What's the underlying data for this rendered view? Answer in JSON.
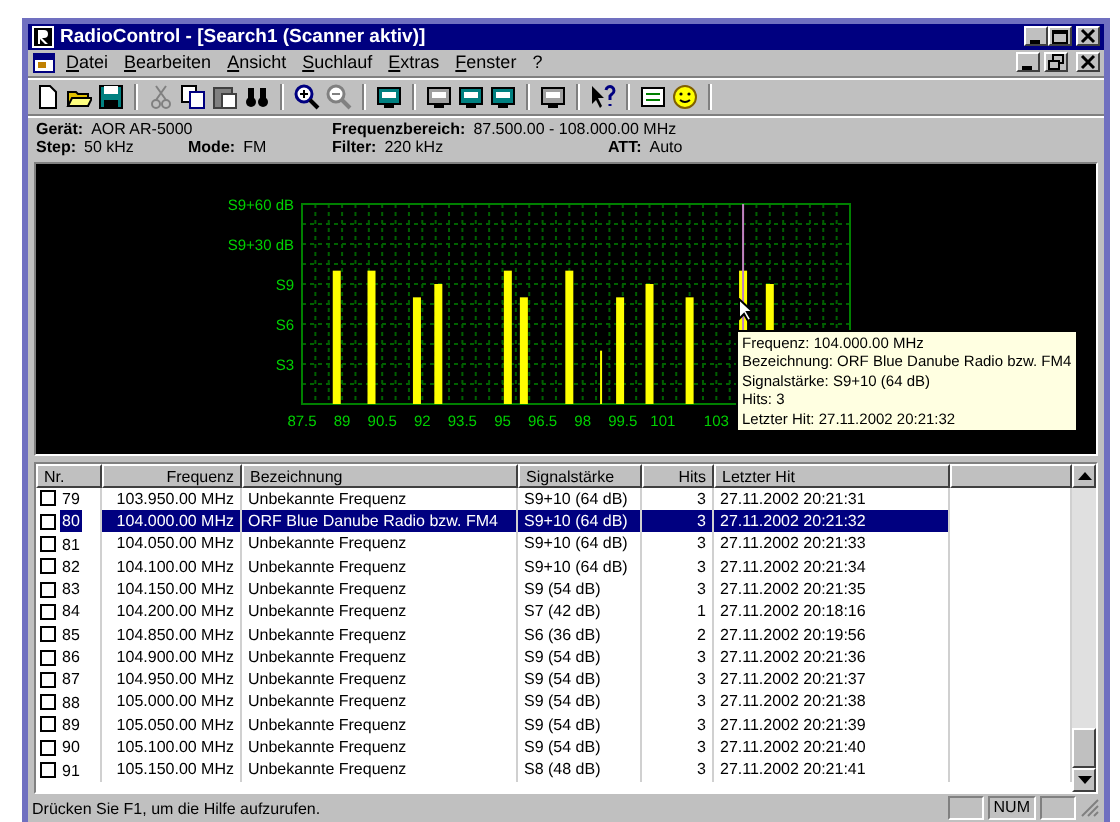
{
  "window": {
    "title": "RadioControl - [Search1 (Scanner aktiv)]"
  },
  "menu": [
    {
      "label": "Datei"
    },
    {
      "label": "Bearbeiten"
    },
    {
      "label": "Ansicht"
    },
    {
      "label": "Suchlauf"
    },
    {
      "label": "Extras"
    },
    {
      "label": "Fenster"
    },
    {
      "label": "?"
    }
  ],
  "info": [
    [
      {
        "label": "Gerät:",
        "value": "AOR AR-5000"
      },
      {
        "label": "Frequenzbereich:",
        "value": "87.500.00 - 108.000.00 MHz"
      }
    ],
    [
      {
        "label": "Step:",
        "value": "50 kHz"
      },
      {
        "label": "Mode:",
        "value": "FM"
      },
      {
        "label": "Filter:",
        "value": "220 kHz"
      },
      {
        "label": "ATT:",
        "value": "Auto"
      }
    ]
  ],
  "spectrum": {
    "y_axis_labels": [
      "S9+60 dB",
      "S9+30 dB",
      "S9",
      "S6",
      "S3"
    ],
    "x_axis_labels": [
      "87.5",
      "89",
      "90.5",
      "92",
      "93.5",
      "95",
      "96.5",
      "98",
      "99.5",
      "101",
      "103"
    ],
    "tooltip": [
      "Frequenz: 104.000.00 MHz",
      "Bezeichnung: ORF Blue Danube Radio bzw. FM4",
      "Signalstärke: S9+10 (64 dB)",
      "Hits: 3",
      "Letzter Hit: 27.11.2002 20:21:32"
    ]
  },
  "table": {
    "columns": [
      "Nr.",
      "Frequenz",
      "Bezeichnung",
      "Signalstärke",
      "Hits",
      "Letzter Hit"
    ],
    "rows": [
      {
        "nr": "79",
        "freq": "103.950.00 MHz",
        "name": "Unbekannte Frequenz",
        "signal": "S9+10 (64 dB)",
        "hits": "3",
        "last": "27.11.2002 20:21:31",
        "checked": false,
        "selected": false
      },
      {
        "nr": "80",
        "freq": "104.000.00 MHz",
        "name": "ORF Blue Danube Radio bzw. FM4",
        "signal": "S9+10 (64 dB)",
        "hits": "3",
        "last": "27.11.2002 20:21:32",
        "checked": false,
        "selected": true
      },
      {
        "nr": "81",
        "freq": "104.050.00 MHz",
        "name": "Unbekannte Frequenz",
        "signal": "S9+10 (64 dB)",
        "hits": "3",
        "last": "27.11.2002 20:21:33",
        "checked": false,
        "selected": false
      },
      {
        "nr": "82",
        "freq": "104.100.00 MHz",
        "name": "Unbekannte Frequenz",
        "signal": "S9+10 (64 dB)",
        "hits": "3",
        "last": "27.11.2002 20:21:34",
        "checked": false,
        "selected": false
      },
      {
        "nr": "83",
        "freq": "104.150.00 MHz",
        "name": "Unbekannte Frequenz",
        "signal": "S9 (54 dB)",
        "hits": "3",
        "last": "27.11.2002 20:21:35",
        "checked": false,
        "selected": false
      },
      {
        "nr": "84",
        "freq": "104.200.00 MHz",
        "name": "Unbekannte Frequenz",
        "signal": "S7 (42 dB)",
        "hits": "1",
        "last": "27.11.2002 20:18:16",
        "checked": false,
        "selected": false
      },
      {
        "nr": "85",
        "freq": "104.850.00 MHz",
        "name": "Unbekannte Frequenz",
        "signal": "S6 (36 dB)",
        "hits": "2",
        "last": "27.11.2002 20:19:56",
        "checked": false,
        "selected": false
      },
      {
        "nr": "86",
        "freq": "104.900.00 MHz",
        "name": "Unbekannte Frequenz",
        "signal": "S9 (54 dB)",
        "hits": "3",
        "last": "27.11.2002 20:21:36",
        "checked": false,
        "selected": false
      },
      {
        "nr": "87",
        "freq": "104.950.00 MHz",
        "name": "Unbekannte Frequenz",
        "signal": "S9 (54 dB)",
        "hits": "3",
        "last": "27.11.2002 20:21:37",
        "checked": false,
        "selected": false
      },
      {
        "nr": "88",
        "freq": "105.000.00 MHz",
        "name": "Unbekannte Frequenz",
        "signal": "S9 (54 dB)",
        "hits": "3",
        "last": "27.11.2002 20:21:38",
        "checked": false,
        "selected": false
      },
      {
        "nr": "89",
        "freq": "105.050.00 MHz",
        "name": "Unbekannte Frequenz",
        "signal": "S9 (54 dB)",
        "hits": "3",
        "last": "27.11.2002 20:21:39",
        "checked": false,
        "selected": false
      },
      {
        "nr": "90",
        "freq": "105.100.00 MHz",
        "name": "Unbekannte Frequenz",
        "signal": "S9 (54 dB)",
        "hits": "3",
        "last": "27.11.2002 20:21:40",
        "checked": false,
        "selected": false
      },
      {
        "nr": "91",
        "freq": "105.150.00 MHz",
        "name": "Unbekannte Frequenz",
        "signal": "S8 (48 dB)",
        "hits": "3",
        "last": "27.11.2002 20:21:41",
        "checked": false,
        "selected": false
      }
    ]
  },
  "status_bar": {
    "message": "Drücken Sie F1, um die Hilfe aufzurufen.",
    "panels": [
      "NUM"
    ]
  }
}
